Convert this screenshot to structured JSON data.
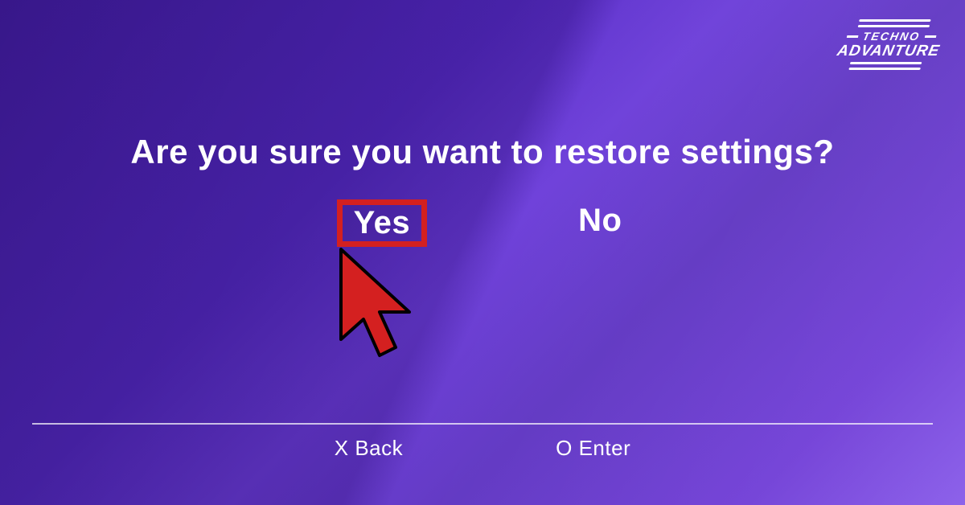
{
  "dialog": {
    "title": "Are you sure you want to restore settings?",
    "options": {
      "yes": "Yes",
      "no": "No"
    }
  },
  "footer": {
    "back": "X Back",
    "enter": "O Enter"
  },
  "logo": {
    "line1": "TECHNO",
    "line2": "ADVANTURE"
  }
}
